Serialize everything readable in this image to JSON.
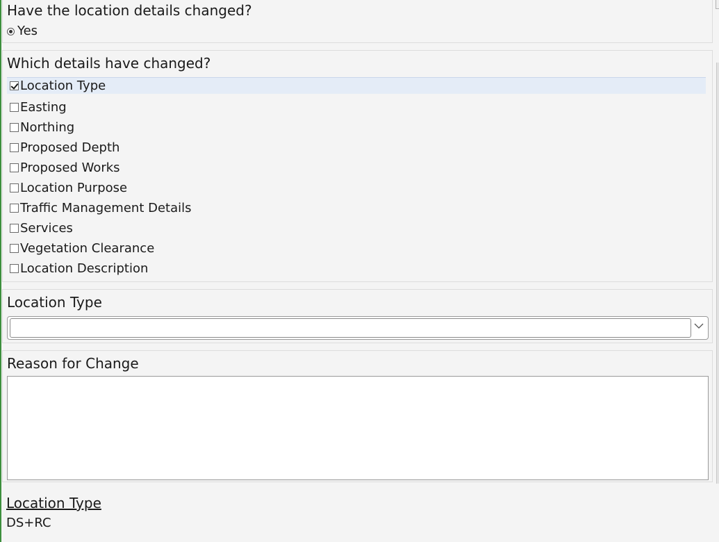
{
  "location_changed": {
    "question": "Have the location details changed?",
    "selected_option": "Yes"
  },
  "changed_details": {
    "question": "Which details have changed?",
    "options": [
      {
        "label": "Location Type",
        "checked": true
      },
      {
        "label": "Easting",
        "checked": false
      },
      {
        "label": "Northing",
        "checked": false
      },
      {
        "label": "Proposed Depth",
        "checked": false
      },
      {
        "label": "Proposed Works",
        "checked": false
      },
      {
        "label": "Location Purpose",
        "checked": false
      },
      {
        "label": "Traffic Management Details",
        "checked": false
      },
      {
        "label": "Services",
        "checked": false
      },
      {
        "label": "Vegetation Clearance",
        "checked": false
      },
      {
        "label": "Location Description",
        "checked": false
      }
    ]
  },
  "location_type": {
    "label": "Location Type",
    "value": ""
  },
  "reason_for_change": {
    "label": "Reason for Change",
    "value": ""
  },
  "summary": {
    "label": "Location Type",
    "value": "DS+RC"
  },
  "colors": {
    "accent": "#3d8f3d",
    "selected_row": "#e4ecf7"
  },
  "icons": {
    "dropdown": "chevron-down-icon",
    "checkbox_checked": "checkmark-icon"
  }
}
